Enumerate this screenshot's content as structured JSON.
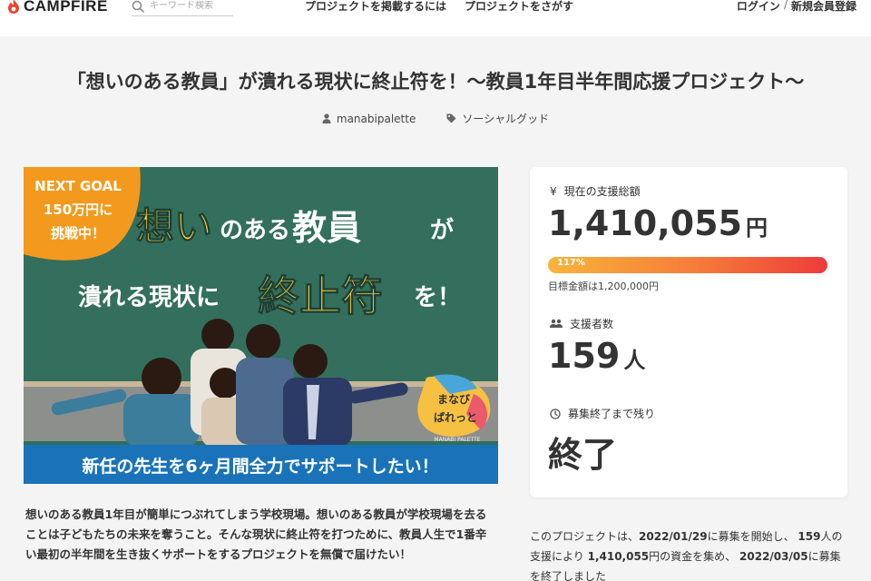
{
  "header": {
    "logo_text": "CAMPFIRE",
    "search_placeholder": "キーワード検索",
    "nav_post": "プロジェクトを掲載するには",
    "nav_find": "プロジェクトをさがす",
    "login": "ログイン",
    "separator": "/",
    "register": "新規会員登録"
  },
  "project": {
    "title": "「想いのある教員」が潰れる現状に終止符を！〜教員1年目半年間応援プロジェクト〜",
    "owner": "manabipalette",
    "category": "ソーシャルグッド"
  },
  "hero": {
    "badge_line1": "NEXT GOAL",
    "badge_line2": "150万円に",
    "badge_line3": "挑戦中！",
    "headline1_big": "想い",
    "headline1_small": "のある",
    "headline1_big2": "教員",
    "headline1_tail": "が",
    "headline2_pre": "潰れる現状に",
    "headline2_big": "終止符",
    "headline2_tail": "を！",
    "logo_line1": "まなび",
    "logo_line2": "ぱれっと",
    "logo_caption": "MANABI PALETTE",
    "banner": "新任の先生を6ヶ月間全力でサポートしたい！"
  },
  "description": "想いのある教員1年目が簡単につぶれてしまう学校現場。想いのある教員が学校現場を去ることは子どもたちの未来を奪うこと。そんな現状に終止符を打つために、教員人生で1番辛い最初の半年間を生き抜くサポートをするプロジェクトを無償で届けたい！",
  "stats": {
    "total_label": "現在の支援総額",
    "total_value": "1,410,055",
    "total_unit": "円",
    "progress_text": "117%",
    "progress_fraction": 1.0,
    "goal_text": "目標金額は1,200,000円",
    "supporters_label": "支援者数",
    "supporters_value": "159",
    "supporters_unit": "人",
    "remaining_label": "募集終了まで残り",
    "remaining_value": "終了"
  },
  "summary": {
    "p1": "このプロジェクトは、",
    "start_date": "2022/01/29",
    "p2": "に募集を開始し、",
    "supporters": "159",
    "p3": "人の支援により",
    "amount": "1,410,055",
    "p4": "円の資金を集め、",
    "end_date": "2022/03/05",
    "p5": "に募集を終了しました"
  },
  "colors": {
    "brand": "#e8432e",
    "progress_start": "#f8b43a",
    "progress_end": "#ee3b3b",
    "hero_green": "#2f6e5a",
    "hero_banner": "#1a73b8",
    "badge_orange": "#f39a1e",
    "headline_yellow": "#f7d23a"
  }
}
